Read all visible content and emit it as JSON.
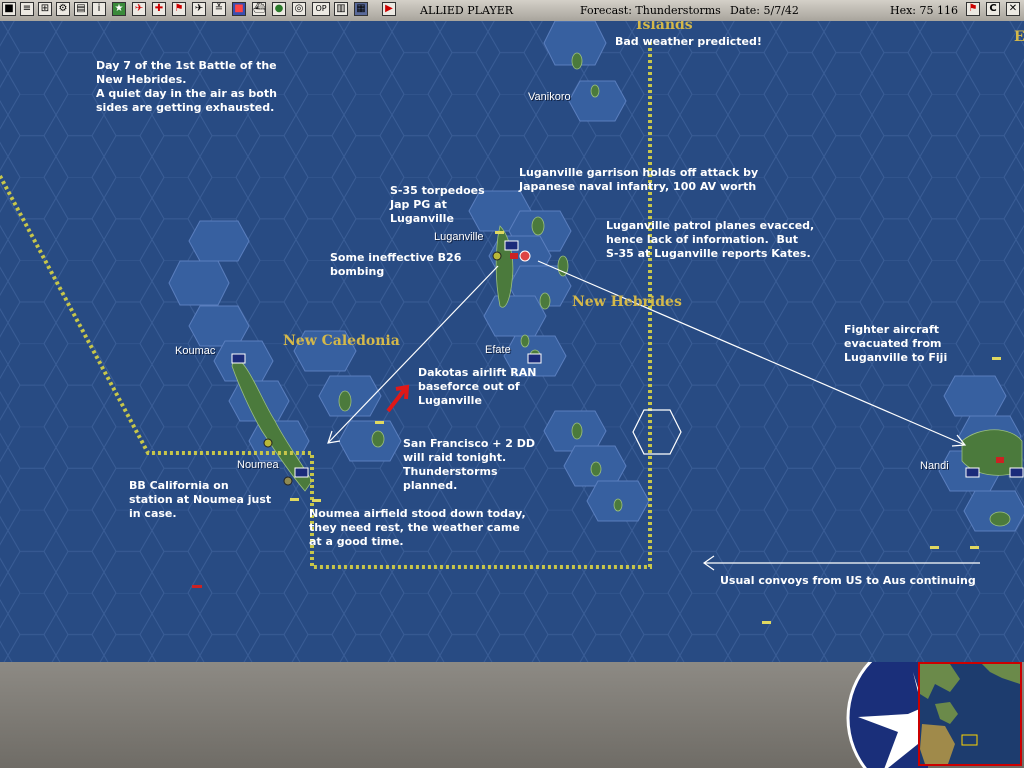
{
  "toolbar": {
    "buttons": [
      "stop",
      "info",
      "zoom",
      "tools",
      "report",
      "advance",
      "plane",
      "ship",
      "flag",
      "base",
      "split",
      "land",
      "scen",
      "globe",
      "opt",
      "sound",
      "weather",
      "play"
    ],
    "side": "ALLIED PLAYER",
    "forecast": "Forecast: Thunderstorms",
    "date": "Date: 5/7/42",
    "hex": "Hex: 75 116",
    "right_buttons": [
      "pin-icon",
      "C-button",
      "close-icon"
    ]
  },
  "map": {
    "regions": [
      {
        "name": "Islands"
      },
      {
        "name": "New Caledonia"
      },
      {
        "name": "New Hebrides"
      },
      {
        "name": "E"
      }
    ],
    "places": [
      {
        "name": "Vanikoro"
      },
      {
        "name": "Luganville"
      },
      {
        "name": "Efate"
      },
      {
        "name": "Koumac"
      },
      {
        "name": "Noumea"
      },
      {
        "name": "Nandi"
      }
    ],
    "notes": [
      {
        "text": "Bad weather predicted!"
      },
      {
        "text": "Day 7 of the 1st Battle of the\nNew Hebrides.\nA quiet day in the air as both\nsides are getting exhausted."
      },
      {
        "text": "Luganville garrison holds off attack by\nJapanese naval infantry, 100 AV worth"
      },
      {
        "text": "S-35 torpedoes\nJap PG at\nLuganville"
      },
      {
        "text": "Luganville patrol planes evacced,\nhence lack of information.  But\nS-35 at Luganville reports Kates."
      },
      {
        "text": "Some ineffective B26\nbombing"
      },
      {
        "text": "Fighter aircraft\nevacuated from\nLuganville to Fiji"
      },
      {
        "text": "Dakotas airlift RAN\nbaseforce out of\nLuganville"
      },
      {
        "text": "San Francisco + 2 DD\nwill raid tonight.\nThunderstorms\nplanned."
      },
      {
        "text": "BB California on\nstation at Noumea just\nin case."
      },
      {
        "text": "Noumea airfield stood down today,\nthey need rest, the weather came\nat a good time."
      },
      {
        "text": "Usual convoys from US to Aus continuing"
      }
    ],
    "colors": {
      "sea": "#284b83",
      "land": "#3f6b3a",
      "border": "#c7c64a",
      "annotation": "#ffffff",
      "arrow_red": "#e01818"
    }
  },
  "status": {
    "minimap_label": "minimap"
  }
}
